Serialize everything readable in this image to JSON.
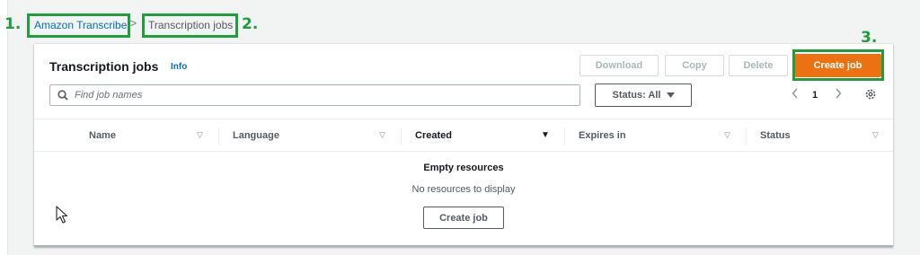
{
  "breadcrumb": {
    "root": "Amazon Transcribe",
    "separator": ">",
    "current": "Transcription jobs"
  },
  "annotations": {
    "step1": "1.",
    "step2": "2.",
    "step3": "3.",
    "highlight_color": "#1f9e3d"
  },
  "panel": {
    "title": "Transcription jobs",
    "info": "Info",
    "actions": {
      "download": "Download",
      "copy": "Copy",
      "delete": "Delete",
      "create": "Create job"
    },
    "search": {
      "placeholder": "Find job names",
      "value": ""
    },
    "status_filter": "Status: All",
    "pagination": {
      "current_page": "1"
    },
    "table": {
      "columns": [
        {
          "label": "Name",
          "sorted": false
        },
        {
          "label": "Language",
          "sorted": false
        },
        {
          "label": "Created",
          "sorted": true
        },
        {
          "label": "Expires in",
          "sorted": false
        },
        {
          "label": "Status",
          "sorted": false
        }
      ]
    },
    "empty": {
      "title": "Empty resources",
      "message": "No resources to display",
      "button": "Create job"
    }
  },
  "colors": {
    "accent": "#ec7211",
    "link": "#0073bb",
    "text": "#16191f",
    "muted": "#545b64"
  }
}
